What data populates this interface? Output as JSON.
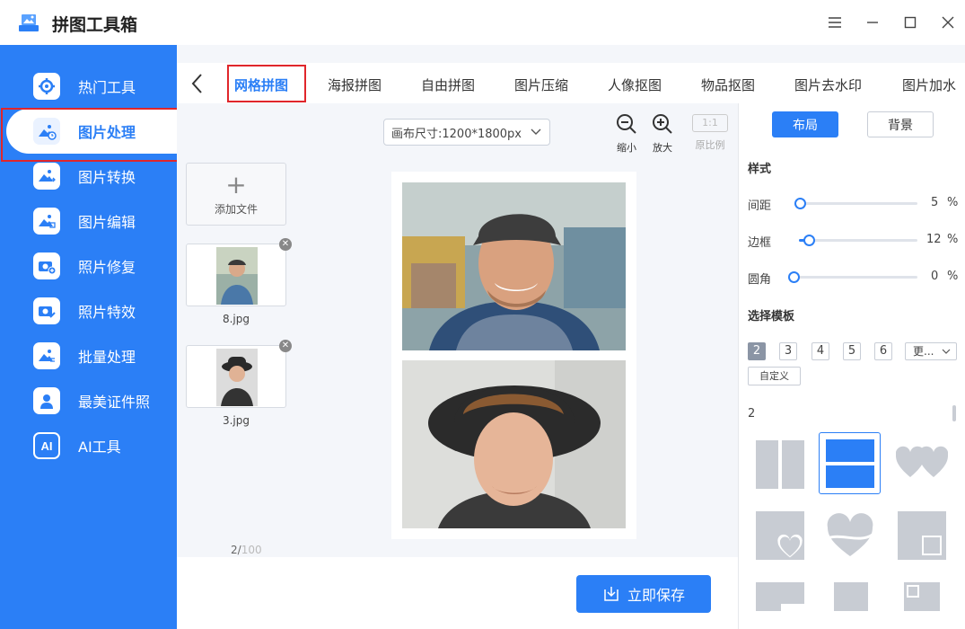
{
  "app": {
    "title": "拼图工具箱"
  },
  "window_controls": {
    "menu": "☰",
    "minimize": "—",
    "maximize": "☐",
    "close": "✕"
  },
  "sidebar": {
    "items": [
      {
        "label": "热门工具",
        "icon": "tools-icon"
      },
      {
        "label": "图片处理",
        "icon": "image-process-icon",
        "active": true
      },
      {
        "label": "图片转换",
        "icon": "image-convert-icon"
      },
      {
        "label": "图片编辑",
        "icon": "image-edit-icon"
      },
      {
        "label": "照片修复",
        "icon": "camera-plus-icon"
      },
      {
        "label": "照片特效",
        "icon": "camera-magic-icon"
      },
      {
        "label": "批量处理",
        "icon": "batch-icon"
      },
      {
        "label": "最美证件照",
        "icon": "id-photo-icon"
      },
      {
        "label": "AI工具",
        "icon": "ai-icon",
        "icon_text": "AI"
      }
    ]
  },
  "tabs": [
    {
      "label": "网格拼图",
      "active": true
    },
    {
      "label": "海报拼图"
    },
    {
      "label": "自由拼图"
    },
    {
      "label": "图片压缩"
    },
    {
      "label": "人像抠图"
    },
    {
      "label": "物品抠图"
    },
    {
      "label": "图片去水印"
    },
    {
      "label": "图片加水"
    }
  ],
  "toolbar": {
    "canvas_size": "画布尺寸:1200*1800px",
    "zoom_out": "缩小",
    "zoom_in": "放大",
    "ratio_box": "1:1",
    "ratio_label": "原比例"
  },
  "files": {
    "add_label": "添加文件",
    "add_icon": "+",
    "items": [
      {
        "name": "8.jpg"
      },
      {
        "name": "3.jpg"
      }
    ],
    "count": "2/",
    "max": "100"
  },
  "save_button": "立即保存",
  "right_panel": {
    "tab_layout": "布局",
    "tab_background": "背景",
    "style_title": "样式",
    "sliders": [
      {
        "label": "间距",
        "value": 5,
        "unit": "%"
      },
      {
        "label": "边框",
        "value": 12,
        "unit": "%"
      },
      {
        "label": "圆角",
        "value": 0,
        "unit": "%"
      }
    ],
    "template_title": "选择模板",
    "count_options": [
      "2",
      "3",
      "4",
      "5",
      "6"
    ],
    "selected_count": "2",
    "more": "更...",
    "custom": "自定义",
    "group_label": "2"
  },
  "colors": {
    "accent": "#2b7ff6",
    "highlight": "#e0262b",
    "tile": "#c8ccd3"
  }
}
